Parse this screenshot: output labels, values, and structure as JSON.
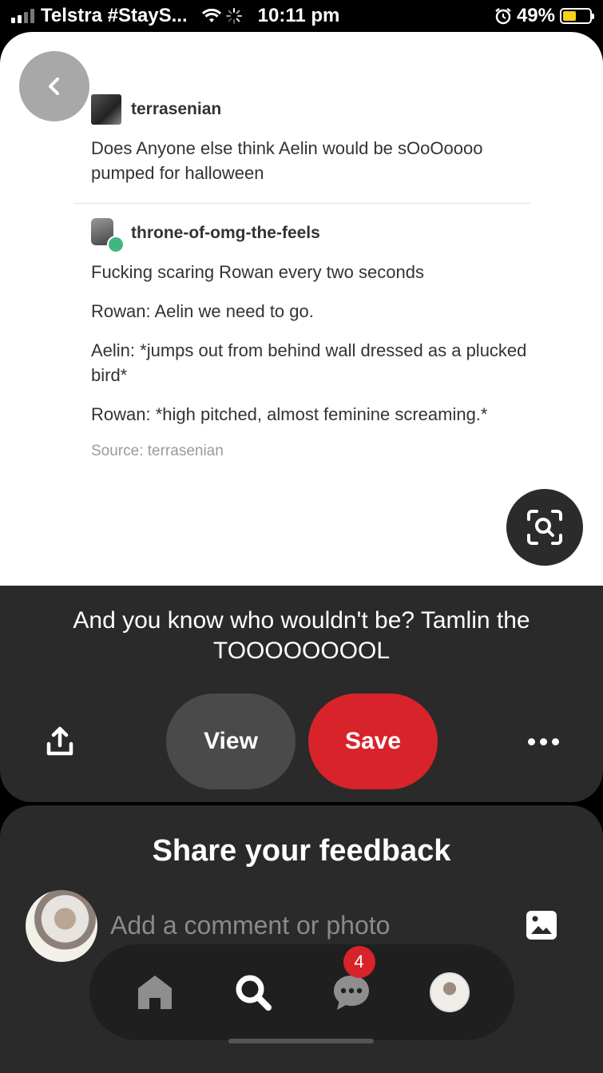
{
  "status_bar": {
    "carrier": "Telstra #StayS...",
    "time": "10:11 pm",
    "battery": "49%",
    "battery_level": 0.49
  },
  "pin": {
    "post": {
      "user1": "terrasenian",
      "text1": "Does Anyone else think Aelin would be sOoOoooo pumped for halloween",
      "user2": "throne-of-omg-the-feels",
      "lines": [
        "Fucking scaring Rowan every two seconds",
        "Rowan: Aelin we need to go.",
        "Aelin: *jumps out from behind wall dressed as a plucked bird*",
        "Rowan: *high pitched, almost feminine screaming.*"
      ],
      "source": "Source: terrasenian"
    },
    "caption": "And you know who wouldn't be? Tamlin the TOOOOOOOOL",
    "view_label": "View",
    "save_label": "Save"
  },
  "feedback": {
    "title": "Share your feedback",
    "placeholder": "Add a comment or photo"
  },
  "nav": {
    "messages_badge": "4"
  },
  "colors": {
    "accent": "#d8232a",
    "panel": "#2a2a2a"
  }
}
